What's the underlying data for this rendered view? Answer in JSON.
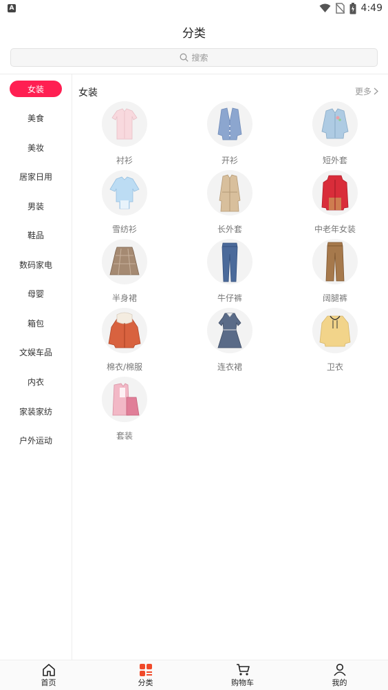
{
  "status": {
    "time": "4:49",
    "app_badge": "A"
  },
  "header": {
    "title": "分类"
  },
  "search": {
    "placeholder": "搜索"
  },
  "sidebar": {
    "items": [
      {
        "label": "女装",
        "active": true
      },
      {
        "label": "美食"
      },
      {
        "label": "美妆"
      },
      {
        "label": "居家日用"
      },
      {
        "label": "男装"
      },
      {
        "label": "鞋品"
      },
      {
        "label": "数码家电"
      },
      {
        "label": "母婴"
      },
      {
        "label": "箱包"
      },
      {
        "label": "文娱车品"
      },
      {
        "label": "内衣"
      },
      {
        "label": "家装家纺"
      },
      {
        "label": "户外运动"
      }
    ]
  },
  "section": {
    "title": "女装",
    "more": "更多",
    "categories": [
      {
        "label": "衬衫",
        "icon": "shirt-icon"
      },
      {
        "label": "开衫",
        "icon": "cardigan-icon"
      },
      {
        "label": "短外套",
        "icon": "denim-jacket-icon"
      },
      {
        "label": "雪纺衫",
        "icon": "chiffon-blouse-icon"
      },
      {
        "label": "长外套",
        "icon": "trench-coat-icon"
      },
      {
        "label": "中老年女装",
        "icon": "padded-coat-icon"
      },
      {
        "label": "半身裙",
        "icon": "skirt-icon"
      },
      {
        "label": "牛仔裤",
        "icon": "jeans-icon"
      },
      {
        "label": "阔腿裤",
        "icon": "wide-pants-icon"
      },
      {
        "label": "棉衣/棉服",
        "icon": "cotton-jacket-icon"
      },
      {
        "label": "连衣裙",
        "icon": "dress-icon"
      },
      {
        "label": "卫衣",
        "icon": "hoodie-icon"
      },
      {
        "label": "套装",
        "icon": "outfit-set-icon"
      }
    ]
  },
  "tabbar": {
    "items": [
      {
        "label": "首页",
        "icon": "home-icon"
      },
      {
        "label": "分类",
        "icon": "category-icon",
        "active": true
      },
      {
        "label": "购物车",
        "icon": "cart-icon"
      },
      {
        "label": "我的",
        "icon": "user-icon"
      }
    ]
  },
  "colors": {
    "accent": "#ff1f52",
    "active_tab": "#f04a2a"
  }
}
